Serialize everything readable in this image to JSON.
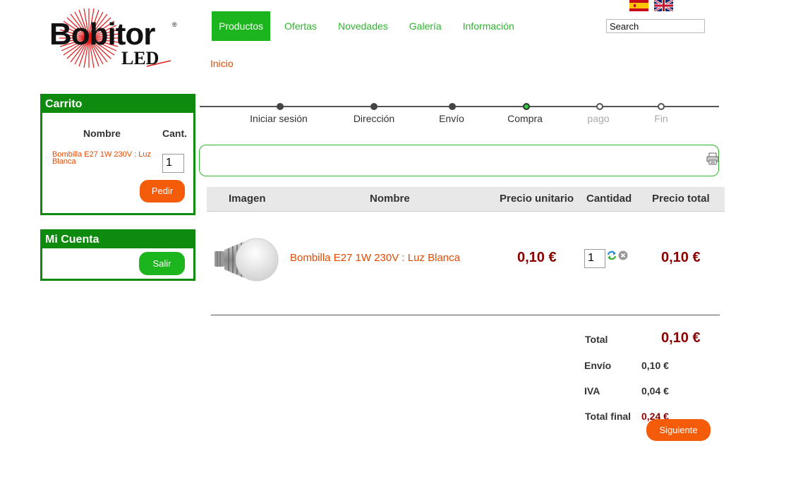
{
  "brand": {
    "name": "Bobitor",
    "sub": "LED",
    "reg": "®"
  },
  "nav": {
    "items": [
      "Productos",
      "Ofertas",
      "Novedades",
      "Galería",
      "Información"
    ]
  },
  "search": {
    "placeholder": "Search"
  },
  "breadcrumb": "Inicio",
  "cart": {
    "title": "Carrito",
    "col_name": "Nombre",
    "col_qty": "Cant.",
    "item_name": "Bombilla E27 1W 230V : Luz Blanca",
    "item_qty": "1",
    "order_button": "Pedir"
  },
  "account": {
    "title": "Mi Cuenta",
    "logout_button": "Salir"
  },
  "steps": [
    "Iniciar sesión",
    "Dirección",
    "Envío",
    "Compra",
    "pago",
    "Fin"
  ],
  "table": {
    "headers": [
      "Imagen",
      "Nombre",
      "Precio unitario",
      "Cantidad",
      "Precio total"
    ],
    "row": {
      "name": "Bombilla E27 1W 230V : Luz Blanca",
      "unit_price": "0,10 €",
      "qty": "1",
      "total": "0,10 €"
    }
  },
  "totals": {
    "total_label": "Total",
    "total_value": "0,10 €",
    "shipping_label": "Envío",
    "shipping_value": "0,10 €",
    "tax_label": "IVA",
    "tax_value": "0,04 €",
    "final_label": "Total final",
    "final_value": "0,24 €"
  },
  "next_button": "Siguiente",
  "colors": {
    "brand_green": "#0e8a0e",
    "nav_green": "#1db51d",
    "accent_orange": "#f45c0a",
    "price_red": "#8b0000"
  }
}
